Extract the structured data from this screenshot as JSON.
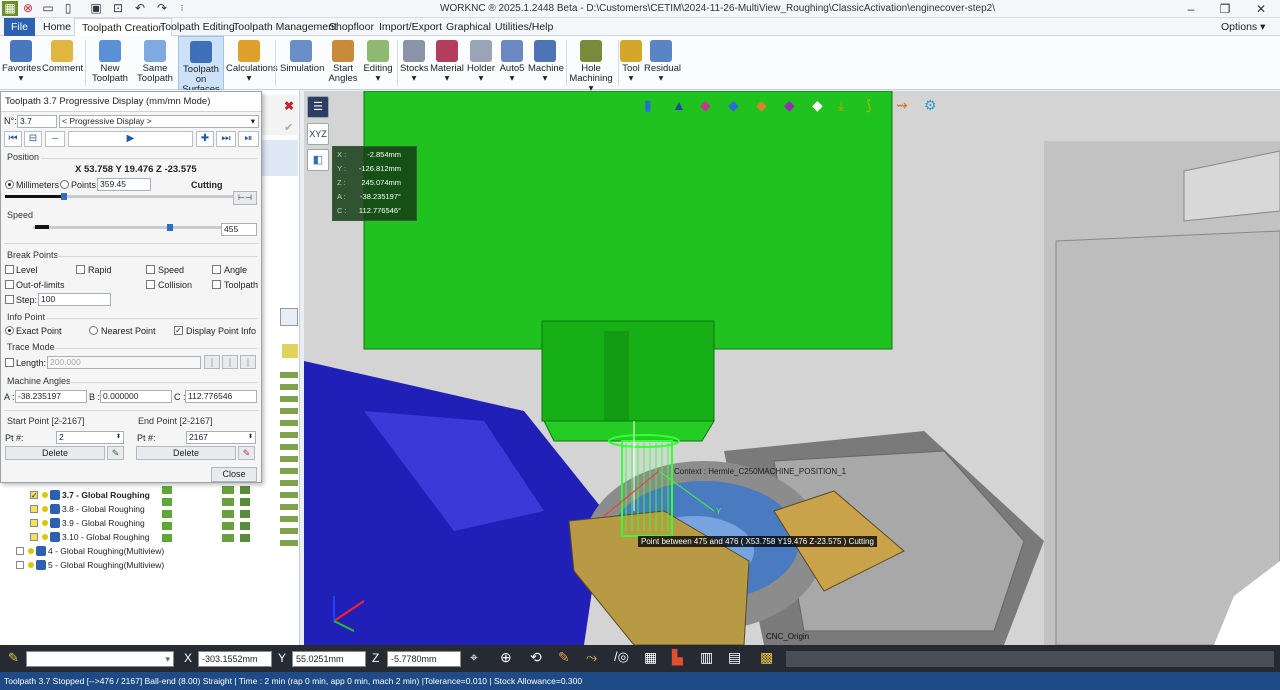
{
  "titlebar": {
    "title": "WORKNC ® 2025.1.2448 Beta - D:\\Customers\\CETIM\\2024-11-26-MultiView_Roughing\\ClassicActivation\\enginecover-step2\\"
  },
  "menu_tabs": [
    "File",
    "Home",
    "Toolpath Creation",
    "Toolpath Editing",
    "Toolpath Management",
    "Shopfloor",
    "Import/Export",
    "Graphical",
    "Utilities/Help"
  ],
  "options_label": "Options ▾",
  "ribbon": [
    {
      "label": "Favorites",
      "sub": "▾"
    },
    {
      "label": "Comment",
      "sub": ""
    },
    {
      "label": "New",
      "sub": "Toolpath"
    },
    {
      "label": "Same",
      "sub": "Toolpath"
    },
    {
      "label": "Toolpath on",
      "sub": "Surfaces"
    },
    {
      "label": "Calculations",
      "sub": "▾"
    },
    {
      "label": "Simulation",
      "sub": ""
    },
    {
      "label": "Start",
      "sub": "Angles"
    },
    {
      "label": "Editing",
      "sub": "▾"
    },
    {
      "label": "Stocks",
      "sub": "▾"
    },
    {
      "label": "Material",
      "sub": "▾"
    },
    {
      "label": "Holder",
      "sub": "▾"
    },
    {
      "label": "Auto5",
      "sub": "▾"
    },
    {
      "label": "Machine",
      "sub": "▾"
    },
    {
      "label": "Hole",
      "sub": "Machining ▾"
    },
    {
      "label": "Tool",
      "sub": "▾"
    },
    {
      "label": "Residual",
      "sub": "▾"
    }
  ],
  "panel": {
    "title": "Toolpath 3.7 Progressive Display (mm/mn Mode)",
    "n_label": "N°:",
    "n_value": "3.7",
    "mode_value": "< Progressive Display >",
    "position_group": "Position",
    "position_readout": "X 53.758 Y 19.476 Z -23.575",
    "millimeters": "Millimeters",
    "points": "Points",
    "points_value": "359.45",
    "cutting": "Cutting",
    "position_slider_value": 0.26,
    "speed_group": "Speed",
    "speed_value": "455",
    "speed_slider_value": 0.73,
    "break_group": "Break Points",
    "break_items": [
      "Level",
      "Rapid",
      "Speed",
      "Angle",
      "Out-of-limits",
      "Collision",
      "Toolpath"
    ],
    "step_label": "Step:",
    "step_value": "100",
    "info_group": "Info Point",
    "exact_point": "Exact Point",
    "nearest_point": "Nearest Point",
    "display_point_info": "Display Point Info",
    "trace_group": "Trace Mode",
    "length_label": "Length:",
    "length_value": "200.000",
    "angles_group": "Machine Angles",
    "a_label": "A :",
    "a_value": "-38.235197",
    "b_label": "B :",
    "b_value": "0.000000",
    "c_label": "C :",
    "c_value": "112.776546",
    "start_group": "Start Point [2-2167]",
    "end_group": "End Point [2-2167]",
    "pt_label": "Pt #:",
    "start_pt": "2",
    "end_pt": "2167",
    "delete": "Delete",
    "close": "Close"
  },
  "tree": [
    {
      "label": "3.7 - Global Roughing",
      "bold": true,
      "checked": true
    },
    {
      "label": "3.8 - Global Roughing",
      "bold": false,
      "checked": false
    },
    {
      "label": "3.9 - Global Roughing",
      "bold": false,
      "checked": false
    },
    {
      "label": "3.10 - Global Roughing",
      "bold": false,
      "checked": false
    },
    {
      "label": "4 - Global Roughing(Multiview)",
      "bold": false,
      "checked": false
    },
    {
      "label": "5 - Global Roughing(Multiview)",
      "bold": false,
      "checked": false
    }
  ],
  "viewport": {
    "hud": [
      {
        "k": "X :",
        "v": "-2.854mm"
      },
      {
        "k": "Y :",
        "v": "-126.812mm"
      },
      {
        "k": "Z :",
        "v": "245.074mm"
      },
      {
        "k": "A :",
        "v": "-38.235197°"
      },
      {
        "k": "C :",
        "v": "112.776546°"
      }
    ],
    "point_tip": "Point between 475 and 476 ( X53.758 Y19.476 Z-23.575 ) Cutting",
    "context_label": "Context : Hermle_C250MACHINE_POSITION_1",
    "origin_label": "CNC_Origin",
    "axis_label": "Y",
    "xyz_label": "XYZ"
  },
  "statusbar": {
    "x_label": "X",
    "x_value": "-303.1552mm",
    "y_label": "Y",
    "y_value": "55.0251mm",
    "z_label": "Z",
    "z_value": "-5.7780mm"
  },
  "infobar": "Toolpath 3.7   Stopped [-->476 / 2167]   Ball-end (8.00) Straight | Time : 2 min (rap 0 min, app 0 min, mach 2 min) |Tolerance=0.010 | Stock Allowance=0.300"
}
